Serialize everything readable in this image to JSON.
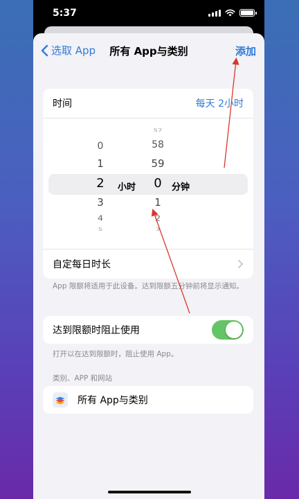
{
  "status_bar": {
    "time": "5:37"
  },
  "nav": {
    "back_label": "选取 App",
    "title": "所有 App与类别",
    "add_label": "添加"
  },
  "time_group": {
    "label": "时间",
    "value": "每天 2小时",
    "picker": {
      "hours": [
        "0",
        "1",
        "2",
        "3",
        "4",
        "5"
      ],
      "minutes": [
        "57",
        "58",
        "59",
        "0",
        "1",
        "2",
        "3"
      ],
      "selected_hour": "2",
      "selected_minute": "0",
      "hour_unit": "小时",
      "minute_unit": "分钟"
    },
    "custom_label": "自定每日时长"
  },
  "time_footnote": "App 限额将适用于此设备。达到限额五分钟前将显示通知。",
  "block_group": {
    "label": "达到限额时阻止使用",
    "toggle_on": true
  },
  "block_footnote": "打开以在达到限额时，阻止使用 App。",
  "section_header": "类别、APP 和网站",
  "category_row": {
    "label": "所有 App与类别"
  },
  "colors": {
    "accent": "#2f7bd6",
    "toggle": "#65c466",
    "annotation": "#d8382b"
  }
}
